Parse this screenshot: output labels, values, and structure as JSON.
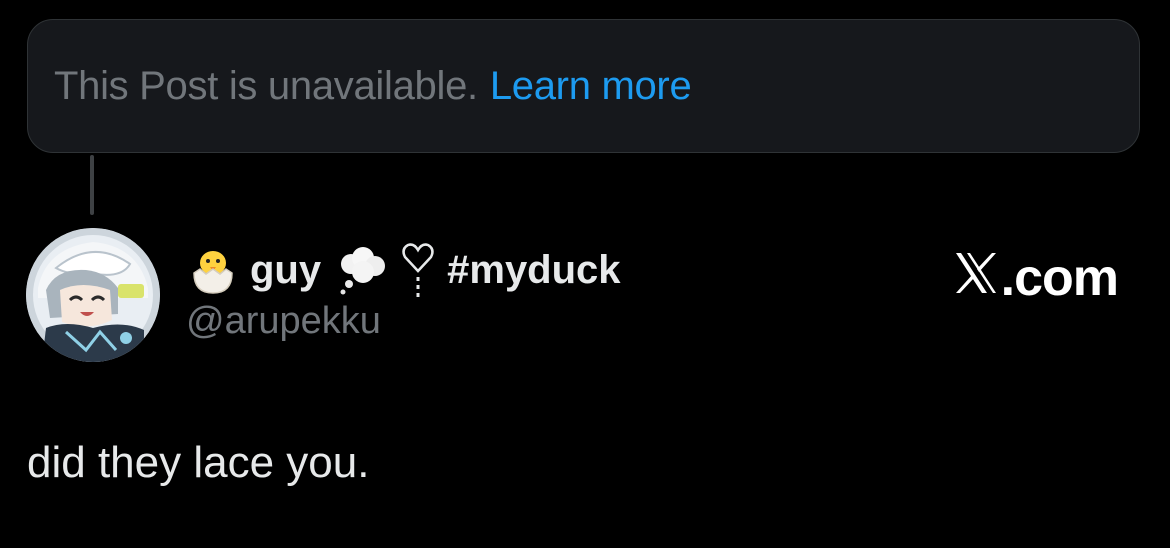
{
  "notice": {
    "message": "This Post is unavailable.",
    "link": "Learn more"
  },
  "author": {
    "display_name": "guy",
    "hashtag": "#myduck",
    "handle": "@arupekku",
    "emojis": [
      "hatching-chick-emoji",
      "thought-balloon-emoji",
      "heart-icon"
    ]
  },
  "post": {
    "text": "did they lace you."
  },
  "brand": {
    "domain": ".com"
  },
  "colors": {
    "background": "#000000",
    "card": "#16181c",
    "muted_text": "#71767b",
    "link": "#1d9bf0",
    "primary_text": "#e7e9ea"
  }
}
